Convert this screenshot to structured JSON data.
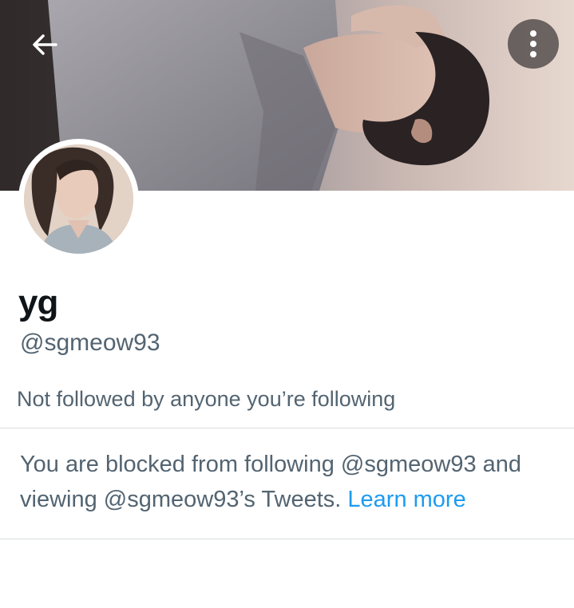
{
  "header": {
    "back_icon": "arrow-left-icon",
    "more_icon": "more-vertical-icon"
  },
  "profile": {
    "display_name": "yg",
    "handle": "@sgmeow93",
    "followers_note": "Not followed by anyone you’re following"
  },
  "blocked": {
    "message": "You are blocked from following @sgmeow93 and viewing @sgmeow93’s Tweets.",
    "link_label": "Learn more"
  },
  "colors": {
    "link": "#1d9bf0",
    "secondary_text": "#536471",
    "primary_text": "#0f1419",
    "divider": "#d8dde1"
  }
}
